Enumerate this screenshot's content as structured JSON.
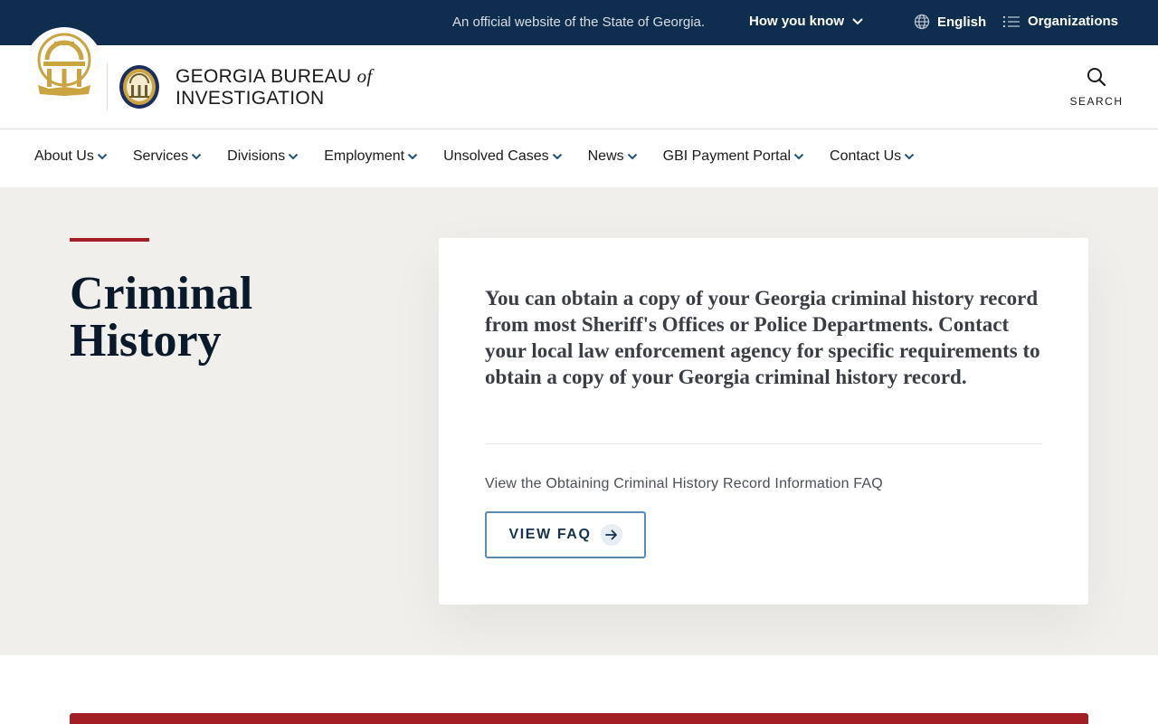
{
  "topbar": {
    "official_text": "An official website of the State of Georgia.",
    "how_you_know": "How you know",
    "language": "English",
    "organizations": "Organizations"
  },
  "header": {
    "brand_line1": "GEORGIA BUREAU",
    "brand_of": "of",
    "brand_line2": "INVESTIGATION",
    "search_label": "SEARCH"
  },
  "nav": {
    "items": [
      {
        "label": "About Us"
      },
      {
        "label": "Services"
      },
      {
        "label": "Divisions"
      },
      {
        "label": "Employment"
      },
      {
        "label": "Unsolved Cases"
      },
      {
        "label": "News"
      },
      {
        "label": "GBI Payment Portal"
      },
      {
        "label": "Contact Us"
      }
    ]
  },
  "hero": {
    "title": "Criminal History",
    "lead": "You can obtain a copy of your Georgia criminal history record from most Sheriff's Offices or Police Departments. Contact your local law enforcement agency for specific requirements to obtain a copy of your Georgia criminal history record.",
    "faq_text": "View the Obtaining Criminal History Record Information FAQ",
    "faq_button": "VIEW FAQ"
  },
  "colors": {
    "topbar": "#0f2d4e",
    "accent_red": "#a31d24",
    "hero_bg": "#f1efec",
    "gold": "#c9a441",
    "button_border": "#5b8bb4"
  }
}
